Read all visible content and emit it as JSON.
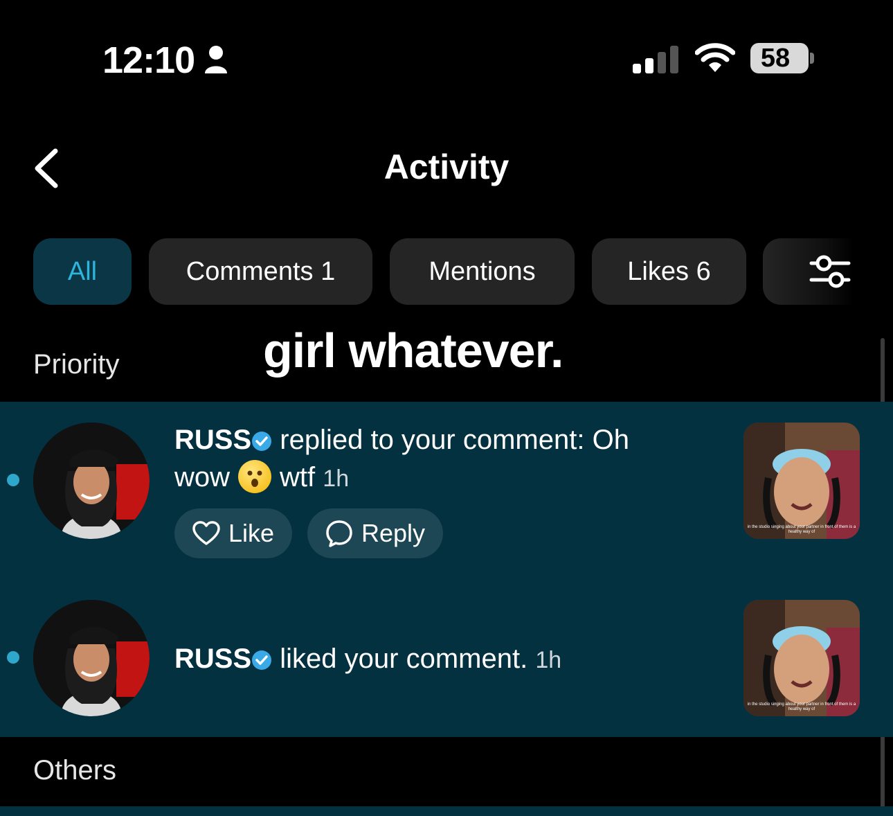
{
  "status_bar": {
    "time": "12:10",
    "battery": "58"
  },
  "header": {
    "title": "Activity"
  },
  "tabs": [
    {
      "label": "All",
      "active": true
    },
    {
      "label": "Comments 1",
      "active": false
    },
    {
      "label": "Mentions",
      "active": false
    },
    {
      "label": "Likes 6",
      "active": false
    }
  ],
  "overlay_text": "girl whatever.",
  "sections": {
    "priority": "Priority",
    "others": "Others"
  },
  "notifications": [
    {
      "username": "RUSS",
      "text_1": "replied to your comment: Oh",
      "text_2a": "wow",
      "text_2b": "wtf",
      "time": "1h",
      "actions": {
        "like": "Like",
        "reply": "Reply"
      },
      "thumb_caption": "in the studio singing about your partner in front of them is a healthy way of"
    },
    {
      "username": "RUSS",
      "text_1": "liked your comment.",
      "time": "1h",
      "thumb_caption": "in the studio singing about your partner in front of them is a healthy way of"
    }
  ],
  "colors": {
    "accent": "#2fb4dc",
    "panel": "#04313f",
    "active_tab_bg": "#0b3646",
    "tab_bg": "#252525",
    "verified": "#39a9e8"
  }
}
